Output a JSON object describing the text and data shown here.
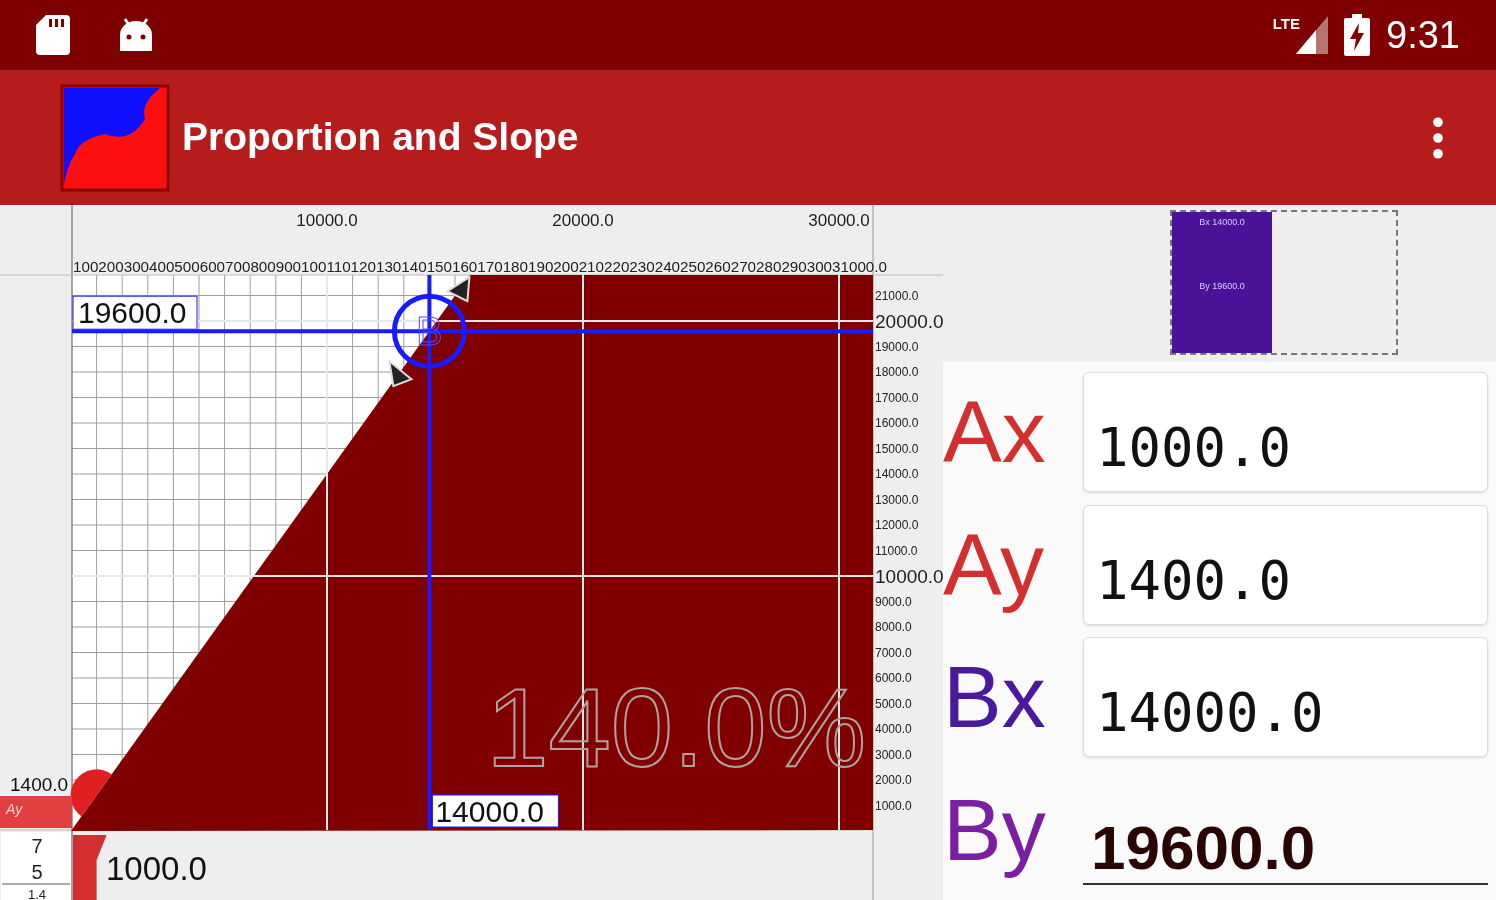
{
  "status_bar": {
    "time": "9:31",
    "network": "LTE"
  },
  "app_bar": {
    "title": "Proportion and Slope"
  },
  "plot": {
    "x_axis_major": [
      "10000.0",
      "20000.0",
      "30000.0"
    ],
    "x_axis_minor": "10020030040050060070080090010011012013014015016017018019020021022023024025026027028029030031000.0",
    "y_axis": [
      {
        "label": "21000.0",
        "major": false
      },
      {
        "label": "20000.0",
        "major": true
      },
      {
        "label": "19000.0",
        "major": false
      },
      {
        "label": "18000.0",
        "major": false
      },
      {
        "label": "17000.0",
        "major": false
      },
      {
        "label": "16000.0",
        "major": false
      },
      {
        "label": "15000.0",
        "major": false
      },
      {
        "label": "14000.0",
        "major": false
      },
      {
        "label": "13000.0",
        "major": false
      },
      {
        "label": "12000.0",
        "major": false
      },
      {
        "label": "11000.0",
        "major": false
      },
      {
        "label": "10000.0",
        "major": true
      },
      {
        "label": "9000.0",
        "major": false
      },
      {
        "label": "8000.0",
        "major": false
      },
      {
        "label": "7000.0",
        "major": false
      },
      {
        "label": "6000.0",
        "major": false
      },
      {
        "label": "5000.0",
        "major": false
      },
      {
        "label": "4000.0",
        "major": false
      },
      {
        "label": "3000.0",
        "major": false
      },
      {
        "label": "2000.0",
        "major": false
      },
      {
        "label": "1000.0",
        "major": false
      }
    ],
    "b_marker": "B",
    "b_y_readout": "19600.0",
    "b_x_readout": "14000.0",
    "a_y_readout": "1400.0",
    "a_y_tag": "Ay",
    "a_x_readout": "1000.0",
    "ratio": {
      "numerator": "7",
      "denominator": "5",
      "value": "1.4"
    },
    "slope_percent": "140.0%"
  },
  "thumbnail": {
    "labels": [
      "Bx 14000.0",
      "By 19600.0"
    ]
  },
  "fields": [
    {
      "label": "Ax",
      "value": "1000.0",
      "focused": false,
      "color": "#d32f2f"
    },
    {
      "label": "Ay",
      "value": "1400.0",
      "focused": false,
      "color": "#d32f2f"
    },
    {
      "label": "Bx",
      "value": "14000.0",
      "focused": false,
      "color": "#4a1a9c"
    },
    {
      "label": "By",
      "value": "19600.0",
      "focused": true,
      "color": "#7b1fa2"
    }
  ]
}
